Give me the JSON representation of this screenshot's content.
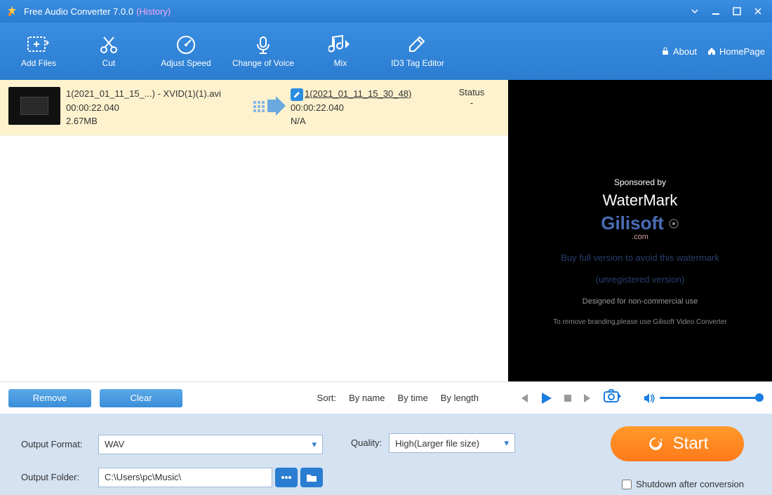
{
  "titlebar": {
    "app_title": "Free Audio Converter 7.0.0",
    "history": "(History)"
  },
  "toolbar": {
    "add_files": "Add Files",
    "cut": "Cut",
    "adjust_speed": "Adjust Speed",
    "change_voice": "Change of Voice",
    "mix": "Mix",
    "id3": "ID3 Tag Editor",
    "about": "About",
    "homepage": "HomePage"
  },
  "file": {
    "src_name": "1(2021_01_11_15_...) - XVID(1)(1).avi",
    "src_duration": "00:00:22.040",
    "src_size": "2.67MB",
    "dst_name": "1(2021_01_11_15_30_48)",
    "dst_duration": "00:00:22.040",
    "dst_size": "N/A",
    "status_hdr": "Status",
    "status_val": "-"
  },
  "preview": {
    "sponsored": "Sponsored by",
    "watermark": "WaterMark",
    "brand": "Gilisoft",
    "brand_suffix": ".com",
    "buy": "Buy full version to avoid this watermark",
    "unreg": "(unregistered version)",
    "designed": "Designed for non-commercial use",
    "remove": "To remove branding,please use Gilisoft Video Converter"
  },
  "actions": {
    "remove": "Remove",
    "clear": "Clear",
    "sort_lbl": "Sort:",
    "by_name": "By name",
    "by_time": "By time",
    "by_length": "By length"
  },
  "settings": {
    "format_lbl": "Output Format:",
    "format_val": "WAV",
    "quality_lbl": "Quality:",
    "quality_val": "High(Larger file size)",
    "folder_lbl": "Output Folder:",
    "folder_val": "C:\\Users\\pc\\Music\\",
    "start": "Start",
    "shutdown": "Shutdown after conversion"
  }
}
